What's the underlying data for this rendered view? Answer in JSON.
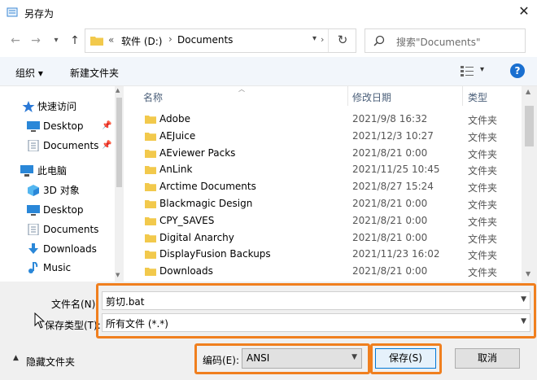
{
  "window": {
    "title": "另存为"
  },
  "address": {
    "drive": "软件 (D:)",
    "folder": "Documents",
    "chevron": "«",
    "sep": "›"
  },
  "search": {
    "placeholder": "搜索\"Documents\""
  },
  "toolbar": {
    "organize": "组织 ▾",
    "new_folder": "新建文件夹"
  },
  "nav": {
    "items": [
      {
        "label": "快速访问",
        "icon": "star-icon"
      },
      {
        "label": "Desktop",
        "icon": "desktop-icon",
        "pinned": true
      },
      {
        "label": "Documents",
        "icon": "document-icon",
        "pinned": true
      },
      {
        "label": "此电脑",
        "icon": "computer-icon"
      },
      {
        "label": "3D 对象",
        "icon": "cube-icon"
      },
      {
        "label": "Desktop",
        "icon": "desktop-icon"
      },
      {
        "label": "Documents",
        "icon": "document-icon"
      },
      {
        "label": "Downloads",
        "icon": "download-icon"
      },
      {
        "label": "Music",
        "icon": "music-icon"
      }
    ]
  },
  "columns": {
    "name": "名称",
    "modified": "修改日期",
    "type": "类型"
  },
  "files": [
    {
      "name": "Adobe",
      "date": "2021/9/8 16:32",
      "type": "文件夹"
    },
    {
      "name": "AEJuice",
      "date": "2021/12/3 10:27",
      "type": "文件夹"
    },
    {
      "name": "AEviewer Packs",
      "date": "2021/8/21 0:00",
      "type": "文件夹"
    },
    {
      "name": "AnLink",
      "date": "2021/11/25 10:45",
      "type": "文件夹"
    },
    {
      "name": "Arctime Documents",
      "date": "2021/8/27 15:24",
      "type": "文件夹"
    },
    {
      "name": "Blackmagic Design",
      "date": "2021/8/21 0:00",
      "type": "文件夹"
    },
    {
      "name": "CPY_SAVES",
      "date": "2021/8/21 0:00",
      "type": "文件夹"
    },
    {
      "name": "Digital Anarchy",
      "date": "2021/8/21 0:00",
      "type": "文件夹"
    },
    {
      "name": "DisplayFusion Backups",
      "date": "2021/11/23 16:02",
      "type": "文件夹"
    },
    {
      "name": "Downloads",
      "date": "2021/8/21 0:00",
      "type": "文件夹"
    }
  ],
  "form": {
    "filename_label": "文件名(N):",
    "filename_value": "剪切.bat",
    "filetype_label": "保存类型(T):",
    "filetype_value": "所有文件 (*.*)",
    "encoding_label": "编码(E):",
    "encoding_value": "ANSI"
  },
  "footer": {
    "hide_folders": "隐藏文件夹",
    "save": "保存(S)",
    "cancel": "取消"
  },
  "colors": {
    "highlight": "#f07f1e",
    "folder": "#f2c94c",
    "accent": "#0078d7"
  }
}
